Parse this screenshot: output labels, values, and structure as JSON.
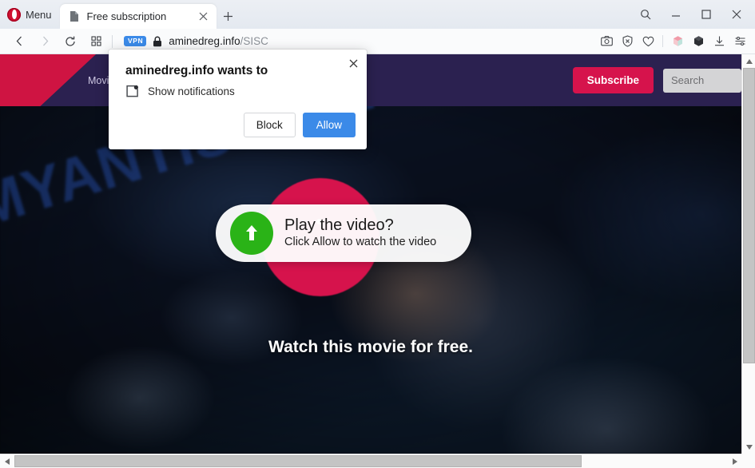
{
  "browser": {
    "menu_label": "Menu",
    "opera_logo_icon": "opera-logo-icon",
    "tab": {
      "title": "Free subscription",
      "favicon_icon": "page-document-icon",
      "close_icon": "close-icon"
    },
    "new_tab_icon": "plus-icon",
    "window_controls": {
      "search_icon": "search-icon",
      "minimize_icon": "minimize-icon",
      "maximize_icon": "maximize-icon",
      "close_icon": "close-icon"
    },
    "nav": {
      "back_icon": "chevron-left-icon",
      "forward_icon": "chevron-right-icon",
      "reload_icon": "reload-icon",
      "speeddial_icon": "grid-icon"
    },
    "address": {
      "vpn_badge": "VPN",
      "lock_icon": "lock-icon",
      "domain": "aminedreg.info",
      "path": "/SISC"
    },
    "page_actions": [
      {
        "name": "snapshot-icon",
        "label": "Snapshot"
      },
      {
        "name": "adblock-shield-icon",
        "label": "Ad blocker"
      },
      {
        "name": "heart-icon",
        "label": "Add to favorites"
      },
      {
        "name": "workspaces-cube-icon",
        "label": "Workspaces"
      },
      {
        "name": "extension-cube-icon",
        "label": "Extensions"
      },
      {
        "name": "download-icon",
        "label": "Downloads"
      },
      {
        "name": "easy-setup-sliders-icon",
        "label": "Easy setup"
      }
    ]
  },
  "site": {
    "nav_links": [
      "Movies"
    ],
    "subscribe_label": "Subscribe",
    "search_placeholder": "Search",
    "watermark": "MYANTISPYWARE.COM",
    "play_overlay": {
      "title": "Play the video?",
      "subtitle": "Click Allow to watch the video",
      "arrow_icon": "arrow-up-icon"
    },
    "free_text": "Watch this movie for free."
  },
  "permission_dialog": {
    "title": "aminedreg.info wants to",
    "permission_icon": "notification-bell-icon",
    "permission_label": "Show notifications",
    "block_label": "Block",
    "allow_label": "Allow",
    "close_icon": "close-icon"
  },
  "colors": {
    "opera_red": "#cf1130",
    "site_purple": "#2b2150",
    "crimson": "#d6134c",
    "allow_blue": "#3b8ae8",
    "play_green": "#2ab317",
    "watermark_blue": "#2856be"
  }
}
